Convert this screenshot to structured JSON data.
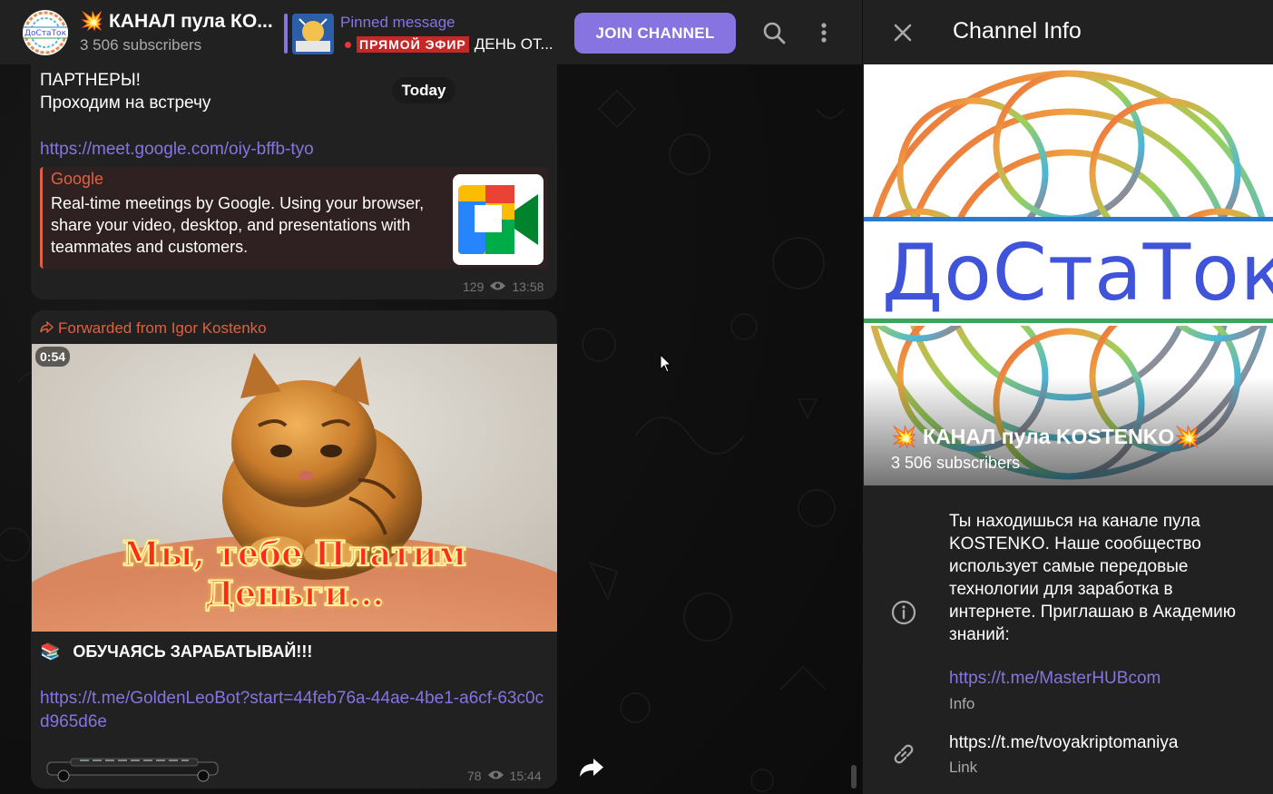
{
  "chat_header": {
    "title": "💥 КАНАЛ пула КО...",
    "subscribers": "3 506 subscribers",
    "avatar_label": "ДоСтаТок",
    "pinned_title": "Pinned message",
    "pinned_badge": "ПРЯМОЙ ЭФИР",
    "pinned_text": "ДЕНЬ ОТ...",
    "join_label": "JOIN CHANNEL"
  },
  "date_pill": "Today",
  "message1": {
    "line1": "ПАРТНЕРЫ!",
    "line2": "Проходим на встречу",
    "link": "https://meet.google.com/oiy-bffb-tyo",
    "preview_site": "Google",
    "preview_desc": "Real-time meetings by Google. Using your browser, share your video, desktop, and presentations with teammates and customers.",
    "views": "129",
    "time": "13:58"
  },
  "message2": {
    "forwarded": "Forwarded from Igor Kostenko",
    "duration": "0:54",
    "video_caption": "Мы, тебе Платим Деньги...",
    "headline_emoji": "📚",
    "headline": "ОБУЧАЯСЬ ЗАРАБАТЫВАЙ!!!",
    "link": "https://t.me/GoldenLeoBot?start=44feb76a-44ae-4be1-a6cf-63c0cd965d6e",
    "views": "78",
    "time": "15:44"
  },
  "info_panel": {
    "title": "Channel Info",
    "cover_logo": "ДоСтаТок",
    "name": "💥 КАНАЛ пула KOSTENKO💥",
    "subscribers": "3 506 subscribers",
    "about": "Ты находишься на канале пула KOSTENKO. Наше сообщество использует самые передовые технологии для заработка в интернете. Приглашаю в Академию знаний:",
    "about_link": "https://t.me/MasterHUBcom",
    "about_label": "Info",
    "link_value": "https://t.me/tvoyakriptomaniya",
    "link_label": "Link"
  },
  "colors": {
    "accent": "#8774e1",
    "forward": "#e0613f",
    "panel": "#212121"
  }
}
